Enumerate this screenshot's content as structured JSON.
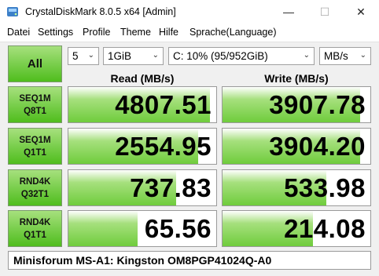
{
  "window": {
    "title": "CrystalDiskMark 8.0.5 x64 [Admin]",
    "minimize_glyph": "—",
    "maximize_glyph": "☐",
    "close_glyph": "✕",
    "app_icon": "disk-icon"
  },
  "menu": [
    "Datei",
    "Settings",
    "Profile",
    "Theme",
    "Hilfe",
    "Sprache(Language)"
  ],
  "controls": {
    "all_label": "All",
    "count": "5",
    "size": "1GiB",
    "drive": "C: 10% (95/952GiB)",
    "unit": "MB/s",
    "arrow_glyph": "⌄"
  },
  "headers": {
    "read": "Read (MB/s)",
    "write": "Write (MB/s)"
  },
  "rows": [
    {
      "label1": "SEQ1M",
      "label2": "Q8T1",
      "read": "4807.51",
      "write": "3907.78",
      "read_fill": 0.96,
      "write_fill": 0.93
    },
    {
      "label1": "SEQ1M",
      "label2": "Q1T1",
      "read": "2554.95",
      "write": "3904.20",
      "read_fill": 0.88,
      "write_fill": 0.93
    },
    {
      "label1": "RND4K",
      "label2": "Q32T1",
      "read": "737.83",
      "write": "533.98",
      "read_fill": 0.73,
      "write_fill": 0.7
    },
    {
      "label1": "RND4K",
      "label2": "Q1T1",
      "read": "65.56",
      "write": "214.08",
      "read_fill": 0.47,
      "write_fill": 0.61
    }
  ],
  "comment": "Minisforum MS-A1: Kingston OM8PGP41024Q-A0",
  "colors": {
    "accent_green": "#4fbd1d",
    "accent_light": "#a6e07d"
  }
}
